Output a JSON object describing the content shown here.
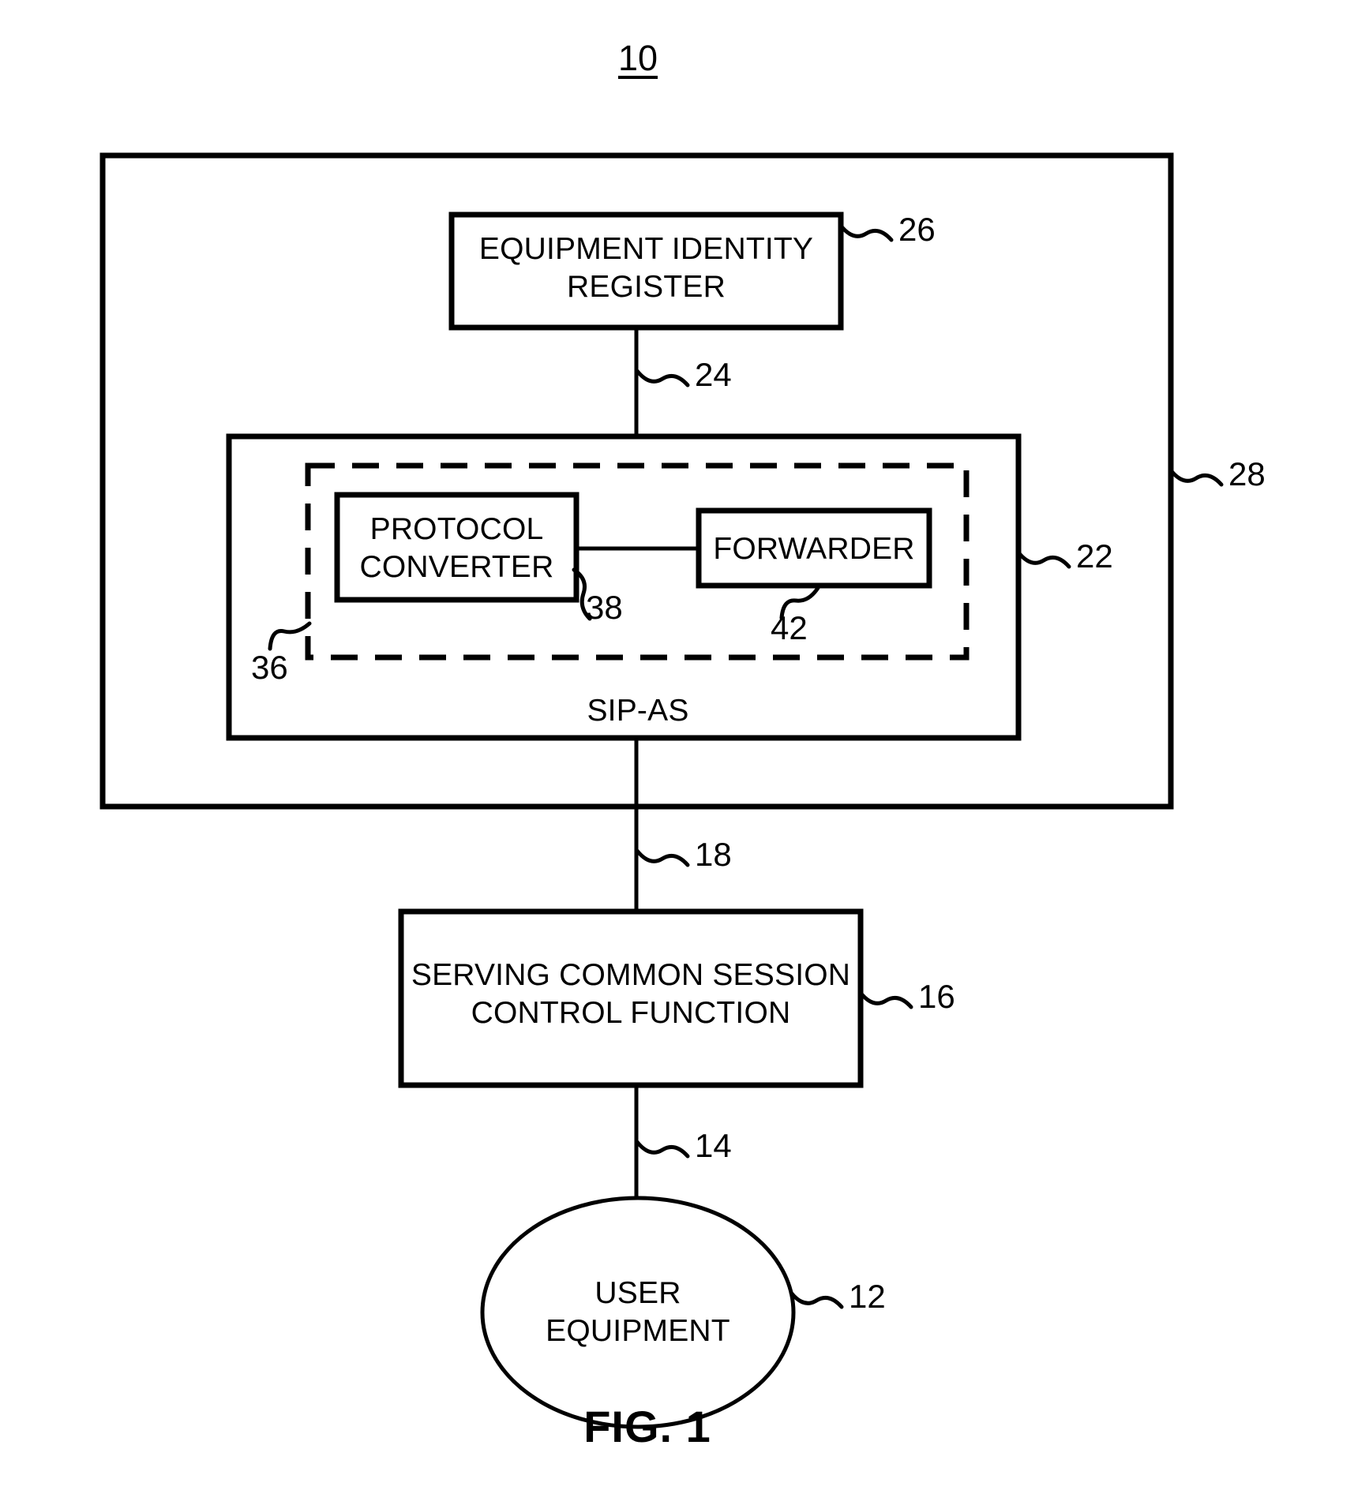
{
  "figure": {
    "system_number": "10",
    "caption": "FIG. 1"
  },
  "nodes": {
    "equipment_identity_register": {
      "label": "EQUIPMENT IDENTITY\nREGISTER",
      "ref": "26"
    },
    "sip_as": {
      "label": "SIP-AS",
      "ref": "22"
    },
    "dashed_module": {
      "ref": "36"
    },
    "protocol_converter": {
      "label": "PROTOCOL\nCONVERTER",
      "ref": "38"
    },
    "forwarder": {
      "label": "FORWARDER",
      "ref": "42"
    },
    "serving_cscf": {
      "label": "SERVING COMMON SESSION\nCONTROL FUNCTION",
      "ref": "16"
    },
    "user_equipment": {
      "label": "USER\nEQUIPMENT",
      "ref": "12"
    },
    "network_boundary": {
      "ref": "28"
    }
  },
  "links": {
    "eir_to_sipas": "24",
    "network_to_scscf": "18",
    "scscf_to_ue": "14"
  },
  "style": {
    "stroke": "#000000",
    "fill": "#ffffff"
  }
}
